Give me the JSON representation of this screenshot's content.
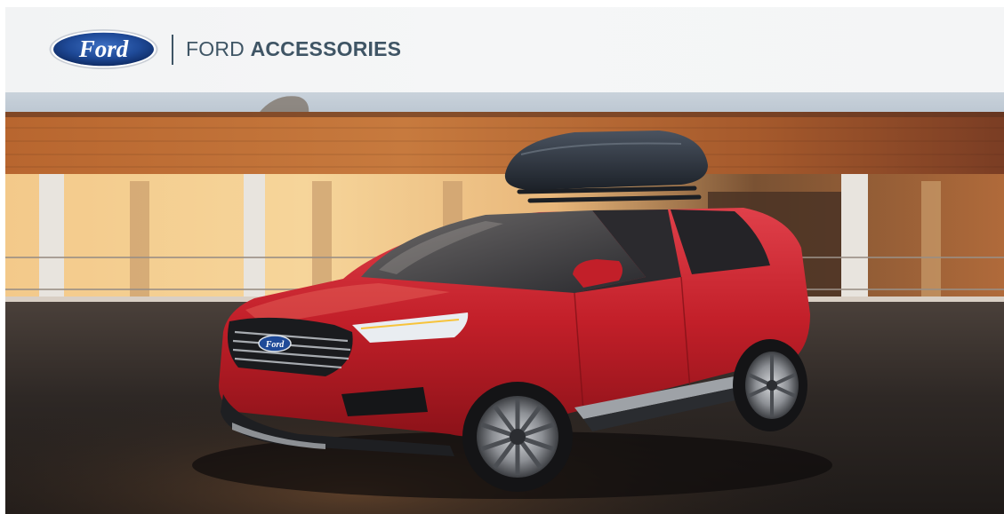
{
  "header": {
    "logo_text": "Ford",
    "brand_prefix": "FORD",
    "brand_suffix": "ACCESSORIES"
  },
  "hero": {
    "grille_badge_text": "Ford"
  },
  "colors": {
    "ford_blue": "#1a3f8a",
    "brand_text": "#3f5565",
    "vehicle_red": "#c8202a",
    "header_bg": "#f3f4f5"
  },
  "icons": {
    "logo": "ford-oval-logo",
    "roof_box": "roof-cargo-box"
  }
}
